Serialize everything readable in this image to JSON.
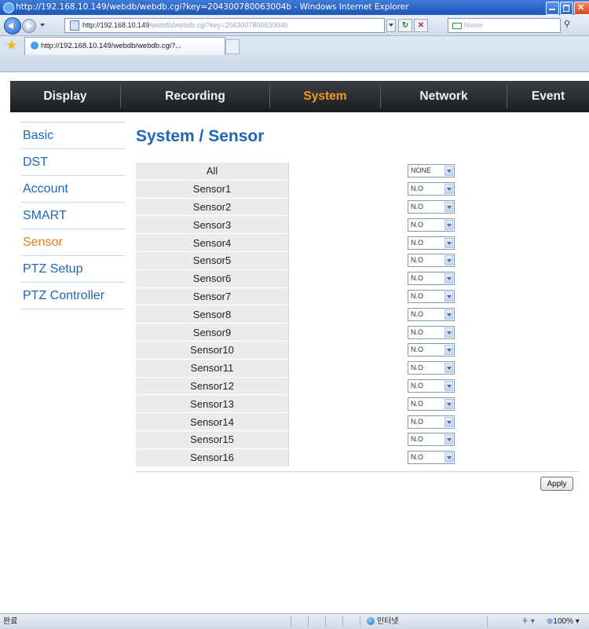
{
  "window": {
    "title": "http://192.168.10.149/webdb/webdb.cgi?key=204300780063004b - Windows Internet Explorer"
  },
  "address_bar": {
    "url_host": "http://192.168.10.149",
    "url_path": "/webdb/webdb.cgi?key=204300780063004b",
    "search_placeholder": "Naver"
  },
  "tab": {
    "label": "http://192.168.10.149/webdb/webdb.cgi?..."
  },
  "main_nav": {
    "items": [
      {
        "label": "Display",
        "active": false
      },
      {
        "label": "Recording",
        "active": false
      },
      {
        "label": "System",
        "active": true
      },
      {
        "label": "Network",
        "active": false
      },
      {
        "label": "Event",
        "active": false
      }
    ]
  },
  "sidebar": {
    "items": [
      {
        "label": "Basic",
        "active": false
      },
      {
        "label": "DST",
        "active": false
      },
      {
        "label": "Account",
        "active": false
      },
      {
        "label": "SMART",
        "active": false
      },
      {
        "label": "Sensor",
        "active": true
      },
      {
        "label": "PTZ Setup",
        "active": false
      },
      {
        "label": "PTZ Controller",
        "active": false
      }
    ]
  },
  "content": {
    "title": "System / Sensor",
    "rows": [
      {
        "label": "All",
        "value": "NONE"
      },
      {
        "label": "Sensor1",
        "value": "N.O"
      },
      {
        "label": "Sensor2",
        "value": "N.O"
      },
      {
        "label": "Sensor3",
        "value": "N.O"
      },
      {
        "label": "Sensor4",
        "value": "N.O"
      },
      {
        "label": "Sensor5",
        "value": "N.O"
      },
      {
        "label": "Sensor6",
        "value": "N.O"
      },
      {
        "label": "Sensor7",
        "value": "N.O"
      },
      {
        "label": "Sensor8",
        "value": "N.O"
      },
      {
        "label": "Sensor9",
        "value": "N.O"
      },
      {
        "label": "Sensor10",
        "value": "N.O"
      },
      {
        "label": "Sensor11",
        "value": "N.O"
      },
      {
        "label": "Sensor12",
        "value": "N.O"
      },
      {
        "label": "Sensor13",
        "value": "N.O"
      },
      {
        "label": "Sensor14",
        "value": "N.O"
      },
      {
        "label": "Sensor15",
        "value": "N.O"
      },
      {
        "label": "Sensor16",
        "value": "N.O"
      }
    ],
    "apply_label": "Apply"
  },
  "status_bar": {
    "left_text": "완료",
    "zone_text": "인터넷",
    "zoom": "100%"
  },
  "colors": {
    "nav_active": "#f59a23",
    "link_blue": "#1e67b6",
    "sidebar_active": "#e87c1e",
    "nav_bg": "#1a1c20"
  }
}
